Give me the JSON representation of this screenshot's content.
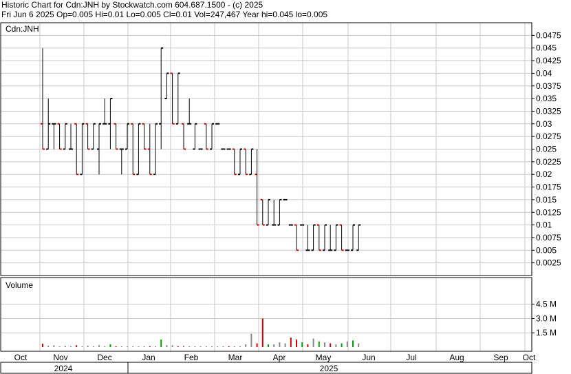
{
  "header": {
    "line1": "Historic Chart for Cdn:JNH by Stockwatch.com 604.687.1500 - (c) 2025",
    "line2": "Fri Jun  6 2025  Op=0.005  Hi=0.01  Lo=0.005  Cl=0.01  Vol=247,467  Year hi=0.045  lo=0.005"
  },
  "chart_data": [
    {
      "type": "ohlc",
      "title": "Cdn:JNH",
      "ylim": [
        0,
        0.05
      ],
      "y_ticks": [
        "0.0475",
        "0.045",
        "0.0425",
        "0.04",
        "0.0375",
        "0.035",
        "0.0325",
        "0.03",
        "0.0275",
        "0.025",
        "0.0225",
        "0.02",
        "0.0175",
        "0.015",
        "0.0125",
        "0.01",
        "0.0075",
        "0.005",
        "0.0025"
      ],
      "x_months": [
        "Oct",
        "Nov",
        "Dec",
        "Jan",
        "Feb",
        "Mar",
        "Apr",
        "May",
        "Jun",
        "Jul",
        "Aug",
        "Sep",
        "Oct"
      ],
      "years": [
        "2024",
        "2025"
      ],
      "grid": true,
      "colors": {
        "up": "#000000",
        "down": "#cc0000",
        "grid": "#c8c8c8"
      },
      "bars": [
        {
          "d": 0,
          "o": 0.03,
          "h": 0.045,
          "l": 0.025,
          "c": 0.025
        },
        {
          "d": 1,
          "o": 0.025,
          "h": 0.035,
          "l": 0.025,
          "c": 0.03
        },
        {
          "d": 2,
          "o": 0.03,
          "h": 0.03,
          "l": 0.025,
          "c": 0.03
        },
        {
          "d": 3,
          "o": 0.03,
          "h": 0.03,
          "l": 0.025,
          "c": 0.025
        },
        {
          "d": 4,
          "o": 0.025,
          "h": 0.03,
          "l": 0.025,
          "c": 0.03
        },
        {
          "d": 5,
          "o": 0.025,
          "h": 0.03,
          "l": 0.025,
          "c": 0.025
        },
        {
          "d": 6,
          "o": 0.03,
          "h": 0.03,
          "l": 0.02,
          "c": 0.02
        },
        {
          "d": 7,
          "o": 0.02,
          "h": 0.03,
          "l": 0.02,
          "c": 0.03
        },
        {
          "d": 8,
          "o": 0.03,
          "h": 0.03,
          "l": 0.025,
          "c": 0.025
        },
        {
          "d": 9,
          "o": 0.025,
          "h": 0.03,
          "l": 0.025,
          "c": 0.03
        },
        {
          "d": 10,
          "o": 0.025,
          "h": 0.03,
          "l": 0.02,
          "c": 0.03
        },
        {
          "d": 11,
          "o": 0.03,
          "h": 0.035,
          "l": 0.03,
          "c": 0.03
        },
        {
          "d": 12,
          "o": 0.03,
          "h": 0.035,
          "l": 0.025,
          "c": 0.035
        },
        {
          "d": 13,
          "o": 0.03,
          "h": 0.03,
          "l": 0.025,
          "c": 0.025
        },
        {
          "d": 14,
          "o": 0.025,
          "h": 0.025,
          "l": 0.02,
          "c": 0.025
        },
        {
          "d": 15,
          "o": 0.025,
          "h": 0.03,
          "l": 0.025,
          "c": 0.03
        },
        {
          "d": 16,
          "o": 0.03,
          "h": 0.03,
          "l": 0.02,
          "c": 0.02
        },
        {
          "d": 17,
          "o": 0.02,
          "h": 0.03,
          "l": 0.02,
          "c": 0.03
        },
        {
          "d": 18,
          "o": 0.03,
          "h": 0.03,
          "l": 0.025,
          "c": 0.025
        },
        {
          "d": 19,
          "o": 0.025,
          "h": 0.03,
          "l": 0.02,
          "c": 0.02
        },
        {
          "d": 20,
          "o": 0.02,
          "h": 0.03,
          "l": 0.02,
          "c": 0.03
        },
        {
          "d": 21,
          "o": 0.03,
          "h": 0.045,
          "l": 0.025,
          "c": 0.045
        },
        {
          "d": 22,
          "o": 0.035,
          "h": 0.04,
          "l": 0.035,
          "c": 0.04
        },
        {
          "d": 23,
          "o": 0.04,
          "h": 0.04,
          "l": 0.03,
          "c": 0.03
        },
        {
          "d": 24,
          "o": 0.03,
          "h": 0.04,
          "l": 0.03,
          "c": 0.04
        },
        {
          "d": 25,
          "o": 0.03,
          "h": 0.03,
          "l": 0.025,
          "c": 0.025
        },
        {
          "d": 26,
          "o": 0.03,
          "h": 0.035,
          "l": 0.03,
          "c": 0.03
        },
        {
          "d": 27,
          "o": 0.025,
          "h": 0.03,
          "l": 0.025,
          "c": 0.03
        },
        {
          "d": 28,
          "o": 0.025,
          "h": 0.025,
          "l": 0.025,
          "c": 0.025
        },
        {
          "d": 29,
          "o": 0.03,
          "h": 0.03,
          "l": 0.025,
          "c": 0.025
        },
        {
          "d": 30,
          "o": 0.025,
          "h": 0.03,
          "l": 0.025,
          "c": 0.03
        },
        {
          "d": 31,
          "o": 0.03,
          "h": 0.03,
          "l": 0.03,
          "c": 0.03
        },
        {
          "d": 32,
          "o": 0.025,
          "h": 0.025,
          "l": 0.025,
          "c": 0.025
        },
        {
          "d": 33,
          "o": 0.025,
          "h": 0.025,
          "l": 0.025,
          "c": 0.025
        },
        {
          "d": 34,
          "o": 0.025,
          "h": 0.025,
          "l": 0.02,
          "c": 0.02
        },
        {
          "d": 35,
          "o": 0.02,
          "h": 0.025,
          "l": 0.02,
          "c": 0.025
        },
        {
          "d": 36,
          "o": 0.025,
          "h": 0.025,
          "l": 0.02,
          "c": 0.02
        },
        {
          "d": 37,
          "o": 0.02,
          "h": 0.025,
          "l": 0.02,
          "c": 0.025
        },
        {
          "d": 38,
          "o": 0.02,
          "h": 0.025,
          "l": 0.01,
          "c": 0.01
        },
        {
          "d": 39,
          "o": 0.015,
          "h": 0.015,
          "l": 0.01,
          "c": 0.01
        },
        {
          "d": 40,
          "o": 0.01,
          "h": 0.015,
          "l": 0.01,
          "c": 0.015
        },
        {
          "d": 41,
          "o": 0.01,
          "h": 0.015,
          "l": 0.01,
          "c": 0.01
        },
        {
          "d": 42,
          "o": 0.01,
          "h": 0.015,
          "l": 0.01,
          "c": 0.015
        },
        {
          "d": 43,
          "o": 0.015,
          "h": 0.015,
          "l": 0.015,
          "c": 0.015
        },
        {
          "d": 44,
          "o": 0.01,
          "h": 0.01,
          "l": 0.01,
          "c": 0.01
        },
        {
          "d": 45,
          "o": 0.01,
          "h": 0.01,
          "l": 0.005,
          "c": 0.005
        },
        {
          "d": 46,
          "o": 0.01,
          "h": 0.01,
          "l": 0.01,
          "c": 0.01
        },
        {
          "d": 47,
          "o": 0.005,
          "h": 0.01,
          "l": 0.005,
          "c": 0.005
        },
        {
          "d": 48,
          "o": 0.005,
          "h": 0.01,
          "l": 0.005,
          "c": 0.01
        },
        {
          "d": 49,
          "o": 0.01,
          "h": 0.01,
          "l": 0.005,
          "c": 0.005
        },
        {
          "d": 50,
          "o": 0.005,
          "h": 0.01,
          "l": 0.005,
          "c": 0.01
        },
        {
          "d": 51,
          "o": 0.005,
          "h": 0.01,
          "l": 0.005,
          "c": 0.005
        },
        {
          "d": 52,
          "o": 0.005,
          "h": 0.01,
          "l": 0.005,
          "c": 0.01
        },
        {
          "d": 53,
          "o": 0.01,
          "h": 0.01,
          "l": 0.005,
          "c": 0.005
        },
        {
          "d": 54,
          "o": 0.005,
          "h": 0.005,
          "l": 0.005,
          "c": 0.005
        },
        {
          "d": 55,
          "o": 0.005,
          "h": 0.01,
          "l": 0.005,
          "c": 0.01
        },
        {
          "d": 56,
          "o": 0.005,
          "h": 0.01,
          "l": 0.005,
          "c": 0.01
        }
      ]
    },
    {
      "type": "bar",
      "title": "Volume",
      "ylim": [
        0,
        6.5
      ],
      "y_unit": "M",
      "y_ticks": [
        "4.5 M",
        "3.0 M",
        "1.5 M"
      ],
      "colors": {
        "up": "#00a000",
        "down": "#cc0000",
        "flat": "#888888"
      },
      "values": [
        0.35,
        0.15,
        0.2,
        0.1,
        0.15,
        0.1,
        0.2,
        0.1,
        0.15,
        0.1,
        0.2,
        0.1,
        0.3,
        0.1,
        0.1,
        0.1,
        0.1,
        0.1,
        0.1,
        0.1,
        0.1,
        0.8,
        0.2,
        0.2,
        0.1,
        0.15,
        0.1,
        0.1,
        0.1,
        0.1,
        0.1,
        0.1,
        0.1,
        0.1,
        0.1,
        0.1,
        0.3,
        1.4,
        0.4,
        3.0,
        0.3,
        0.3,
        0.5,
        0.4,
        1.0,
        0.8,
        0.5,
        0.3,
        0.9,
        0.6,
        0.5,
        0.4,
        0.3,
        0.4,
        0.6,
        0.7,
        0.4
      ],
      "up_days": [
        12,
        21,
        40,
        46,
        49,
        53,
        55
      ],
      "down_days": [
        0,
        6,
        13,
        19,
        24,
        33,
        38,
        39,
        44,
        45,
        47,
        51
      ]
    }
  ]
}
